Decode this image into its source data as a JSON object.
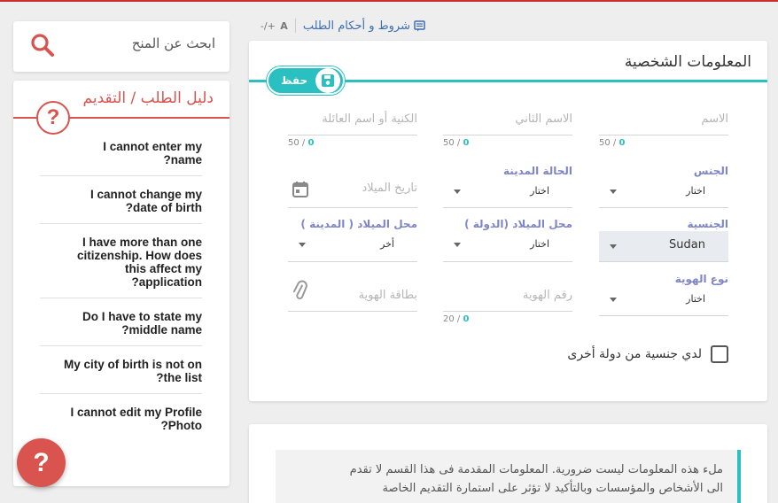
{
  "topbar": {
    "terms_label": "شروط و أحكام الطلب",
    "font_size_label": "A",
    "font_size_controls": "-/+"
  },
  "form": {
    "title": "المعلومات الشخصية",
    "save_label": "حفظ",
    "first_name": {
      "placeholder": "الاسم",
      "count": "0",
      "max": "50"
    },
    "second_name": {
      "placeholder": "الاسم الثاني",
      "count": "0",
      "max": "50"
    },
    "family_name": {
      "placeholder": "الكنية أو اسم العائلة",
      "count": "0",
      "max": "50"
    },
    "gender": {
      "label": "الجنس",
      "value": "اختار"
    },
    "civil_status": {
      "label": "الحالة المدينة",
      "value": "اختار"
    },
    "birth_date": {
      "placeholder": "تاريخ الميلاد"
    },
    "nationality": {
      "label": "الجنسية",
      "value": "Sudan"
    },
    "birth_country": {
      "label": "محل الميلاد (الدولة )",
      "value": "اختار"
    },
    "birth_city": {
      "label": "محل الميلاد ( المدينة )",
      "value": "أخر"
    },
    "id_type": {
      "label": "نوع الهوية",
      "value": "اختار"
    },
    "id_number": {
      "placeholder": "رقم الهوية",
      "count": "0",
      "max": "20"
    },
    "id_card": {
      "placeholder": "بطاقة الهوية"
    },
    "other_nationality_label": "لدي جنسية من دولة أخرى"
  },
  "note": {
    "line1": "ملء هذه المعلومات ليست ضرورية. المعلومات المقدمة فى هذا القسم لا تقدم",
    "line2": "الى الأشخاص والمؤسسات وبالتأكيد لا تؤثر على استمارة التقديم الخاصة"
  },
  "search": {
    "label": "ابحث عن المنح"
  },
  "guide": {
    "title": "دليل الطلب / التقديم",
    "items": [
      "I cannot enter my\n?name",
      "I cannot change my\n?date of birth",
      "I have more than one\ncitizenship. How does\nthis affect my\n?application",
      "Do I have to state my\n?middle name",
      "My city of birth is not on\n?the list",
      "I cannot edit my Profile\n?Photo"
    ]
  },
  "help_fab": "?",
  "colors": {
    "teal": "#2abfc1",
    "red": "#d9534f",
    "label_purple": "#7f86c8",
    "link_blue": "#3d6eb5"
  }
}
